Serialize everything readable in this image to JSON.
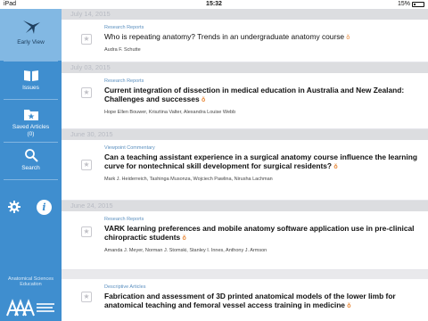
{
  "status_bar": {
    "carrier": "iPad",
    "time": "15:32",
    "battery": "15%"
  },
  "sidebar": {
    "items": [
      {
        "label": "Early View",
        "icon": "early-view-bird-icon",
        "active": true
      },
      {
        "label": "Issues",
        "icon": "book-icon",
        "active": false
      },
      {
        "label": "Saved Articles\n(0)",
        "icon": "saved-folder-star-icon",
        "active": false
      },
      {
        "label": "Search",
        "icon": "search-icon",
        "active": false
      }
    ],
    "settings_icon": "gear-icon",
    "info_icon": "info-icon",
    "info_glyph": "i",
    "journal_name": "Anatomical Sciences\nEducation",
    "logo_label": "AAA"
  },
  "sections": [
    {
      "date": "July 14, 2015",
      "articles": [
        {
          "category": "Research Reports",
          "title": "Who is repeating anatomy? Trends in an undergraduate anatomy course",
          "authors": "Audra F. Schutte",
          "bold": false
        }
      ]
    },
    {
      "date": "July 03, 2015",
      "articles": [
        {
          "category": "Research Reports",
          "title": "Current integration of dissection in medical education in Australia and New Zealand: Challenges and successes",
          "authors": "Hope Ellen Bouwer, Krisztina Valter, Alexandra Louise Webb",
          "bold": true
        }
      ]
    },
    {
      "date": "June 30, 2015",
      "articles": [
        {
          "category": "Viewpoint Commentary",
          "title": "Can a teaching assistant experience in a surgical anatomy course influence the learning curve for nontechnical skill development for surgical residents?",
          "authors": "Mark J. Heiderreich, Tashinga Musonza, Wojciech Pawlina, Nirusha Lachman",
          "bold": true
        }
      ]
    },
    {
      "date": "June 24, 2015",
      "articles": [
        {
          "category": "Research Reports",
          "title": "VARK learning preferences and mobile anatomy software application use in pre-clinical chiropractic students",
          "authors": "Amanda J. Meyer, Norman J. Stomski, Stanley I. Innes, Anthony J. Armson",
          "bold": true
        },
        {
          "category": "Descriptive Articles",
          "title": "Fabrication and assessment of 3D printed anatomical models of the lower limb for anatomical teaching and femoral vessel access training in medicine",
          "authors": "",
          "bold": true
        }
      ]
    }
  ],
  "open_access_glyph": "ǒ",
  "star_glyph": "★",
  "colors": {
    "sidebar": "#3f8ecf",
    "active": "#82b8e3",
    "category": "#5a8fbf",
    "oa": "#e8893a"
  }
}
